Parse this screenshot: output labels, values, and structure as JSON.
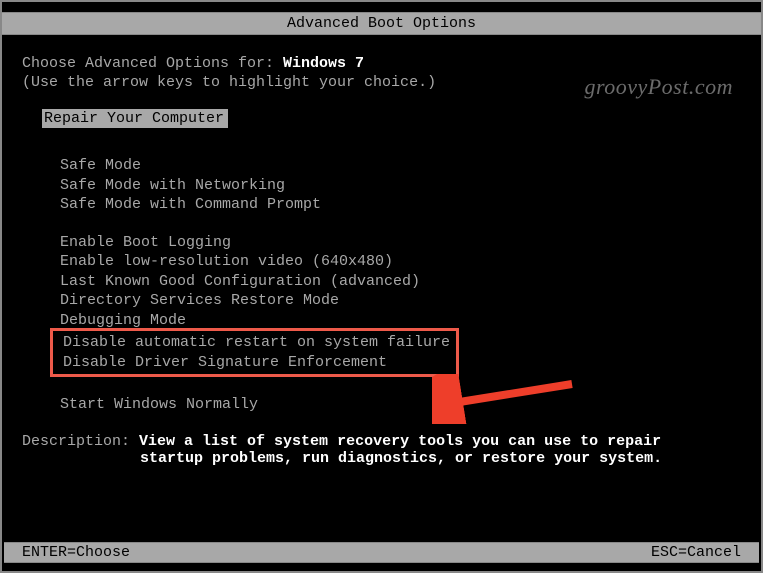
{
  "title": "Advanced Boot Options",
  "choose_prefix": "Choose Advanced Options for: ",
  "os_name": "Windows 7",
  "hint": "(Use the arrow keys to highlight your choice.)",
  "selected_option": "Repair Your Computer",
  "option_groups": [
    [
      "Safe Mode",
      "Safe Mode with Networking",
      "Safe Mode with Command Prompt"
    ],
    [
      "Enable Boot Logging",
      "Enable low-resolution video (640x480)",
      "Last Known Good Configuration (advanced)",
      "Directory Services Restore Mode",
      "Debugging Mode",
      "Disable automatic restart on system failure",
      "Disable Driver Signature Enforcement"
    ],
    [
      "Start Windows Normally"
    ]
  ],
  "highlighted_indices": [
    5,
    6
  ],
  "description_label": "Description: ",
  "description_line1": "View a list of system recovery tools you can use to repair",
  "description_line2": "startup problems, run diagnostics, or restore your system.",
  "footer_left": "ENTER=Choose",
  "footer_right": "ESC=Cancel",
  "watermark": "groovyPost.com",
  "arrow_color": "#ee3e2a"
}
